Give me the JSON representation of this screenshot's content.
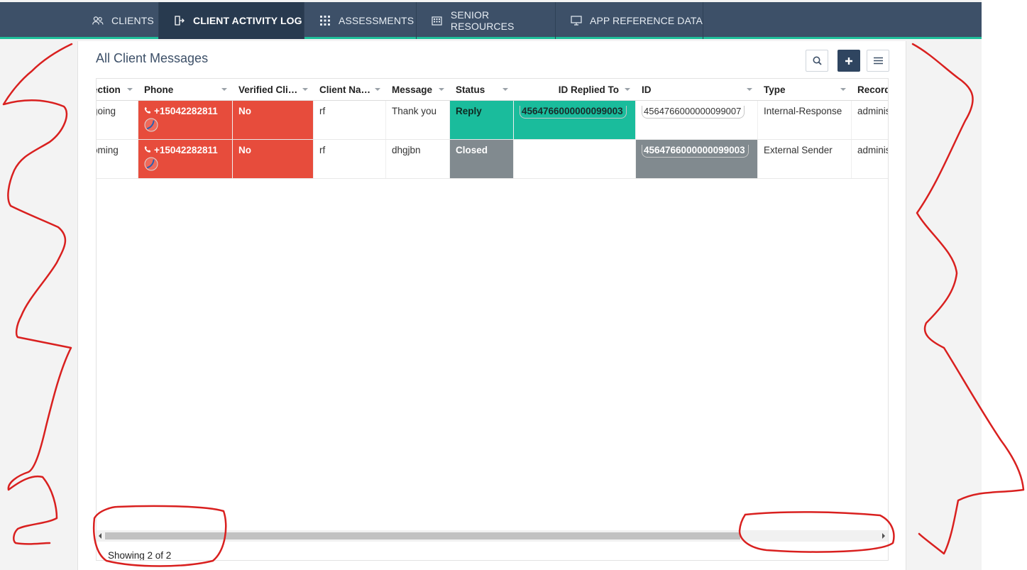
{
  "nav": {
    "tabs": [
      {
        "label": "CLIENTS",
        "icon": "users-icon"
      },
      {
        "label": "CLIENT ACTIVITY LOG",
        "icon": "sign-in-icon"
      },
      {
        "label": "ASSESSMENTS",
        "icon": "grid-icon"
      },
      {
        "label": "SENIOR RESOURCES",
        "icon": "building-icon"
      },
      {
        "label": "APP REFERENCE DATA",
        "icon": "monitor-icon"
      }
    ],
    "active": "CLIENT ACTIVITY LOG"
  },
  "main": {
    "title": "All Client Messages",
    "toolbar": {
      "search": "search-icon",
      "add": "plus-icon",
      "menu": "hamburger-icon"
    }
  },
  "table": {
    "columns": [
      "ection",
      "Phone",
      "Verified Cli…",
      "Client Na…",
      "Message",
      "Status",
      "ID Replied To",
      "ID",
      "Type",
      "Record"
    ],
    "rows": [
      {
        "direction": "going",
        "phone": "+15042282811",
        "verified": "No",
        "client_name": "rf",
        "message": "Thank you",
        "status": "Reply",
        "id_replied_to": "4564766000000099003",
        "id": "4564766000000099007",
        "type": "Internal-Response",
        "record": "adminis"
      },
      {
        "direction": "oming",
        "phone": "+15042282811",
        "verified": "No",
        "client_name": "rf",
        "message": "dhgjbn",
        "status": "Closed",
        "id_replied_to": "",
        "id": "4564766000000099003",
        "type": "External Sender",
        "record": "adminis"
      }
    ],
    "footer": "Showing 2 of 2"
  },
  "colors": {
    "nav_bg": "#3d5068",
    "nav_active": "#283a4f",
    "accent": "#1fbf9a",
    "red": "#e74c3c",
    "teal": "#1abc9c",
    "grey": "#818a8f",
    "annotation": "#d9201f"
  }
}
